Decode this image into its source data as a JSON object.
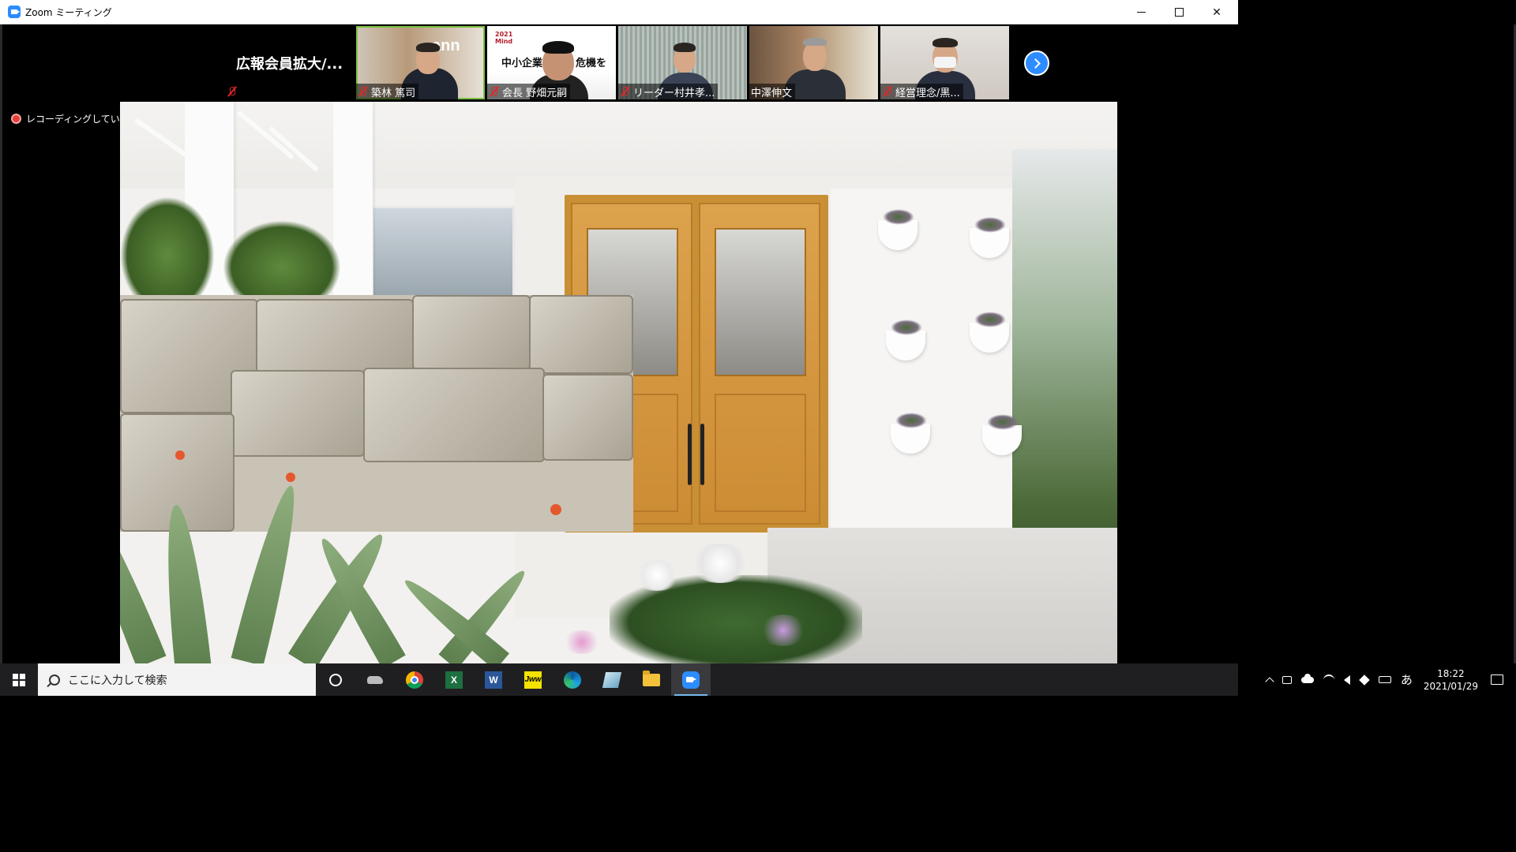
{
  "window": {
    "title": "Zoom ミーティング",
    "minimize_label": "",
    "maximize_label": "",
    "close_label": "✕"
  },
  "strip": {
    "meeting_name": "広報会員拡大/...",
    "participants": [
      {
        "name": "築林 篤司",
        "muted": true,
        "active_speaker": true
      },
      {
        "name": "会長 野畑元嗣",
        "muted": true
      },
      {
        "name": "リーダー村井孝...",
        "muted": true
      },
      {
        "name": "中澤伸文",
        "muted": false
      },
      {
        "name": "経営理念/黒...",
        "muted": true
      }
    ],
    "slide_text_left": "中小企業",
    "slide_text_right": "危機を",
    "slide_badge": "2021 Mind",
    "logo_text": "ann"
  },
  "recording": {
    "label": "レコーディングしています",
    "color": "#e5403a"
  },
  "taskbar": {
    "search_placeholder": "ここに入力して検索",
    "apps": [
      "cortana-icon",
      "cat-app-icon",
      "chrome-icon",
      "excel-icon",
      "word-icon",
      "jww-icon",
      "edge-icon",
      "tile-app-icon",
      "file-explorer-icon",
      "zoom-icon"
    ],
    "excel_letter": "X",
    "word_letter": "W",
    "jww_label": "Jww",
    "ime": "あ",
    "time": "18:22",
    "date": "2021/01/29"
  },
  "colors": {
    "zoom_blue": "#2d8cff",
    "active_speaker_outline": "#7cc142",
    "mute_red": "#e02828"
  }
}
